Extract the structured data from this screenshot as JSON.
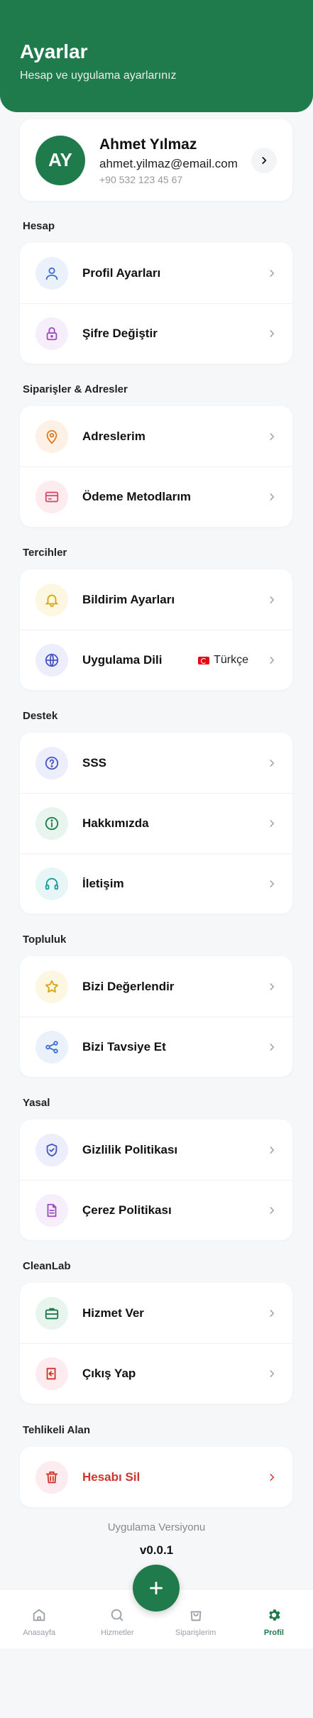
{
  "header": {
    "title": "Ayarlar",
    "subtitle": "Hesap ve uygulama ayarlarınız"
  },
  "profile": {
    "initials": "AY",
    "name": "Ahmet Yılmaz",
    "email": "ahmet.yilmaz@email.com",
    "phone": "+90 532 123 45 67"
  },
  "sections": {
    "hesap": {
      "title": "Hesap",
      "items": [
        {
          "label": "Profil Ayarları",
          "icon": "user-icon"
        },
        {
          "label": "Şifre Değiştir",
          "icon": "lock-icon"
        }
      ]
    },
    "siparis": {
      "title": "Siparişler & Adresler",
      "items": [
        {
          "label": "Adreslerim",
          "icon": "location-pin-icon"
        },
        {
          "label": "Ödeme Metodlarım",
          "icon": "credit-card-icon"
        }
      ]
    },
    "tercihler": {
      "title": "Tercihler",
      "items": [
        {
          "label": "Bildirim Ayarları",
          "icon": "bell-icon"
        },
        {
          "label": "Uygulama Dili",
          "icon": "globe-icon",
          "value": "Türkçe"
        }
      ]
    },
    "destek": {
      "title": "Destek",
      "items": [
        {
          "label": "SSS",
          "icon": "help-circle-icon"
        },
        {
          "label": "Hakkımızda",
          "icon": "info-icon"
        },
        {
          "label": "İletişim",
          "icon": "headphones-icon"
        }
      ]
    },
    "topluluk": {
      "title": "Topluluk",
      "items": [
        {
          "label": "Bizi Değerlendir",
          "icon": "star-icon"
        },
        {
          "label": "Bizi Tavsiye Et",
          "icon": "share-icon"
        }
      ]
    },
    "yasal": {
      "title": "Yasal",
      "items": [
        {
          "label": "Gizlilik Politikası",
          "icon": "shield-check-icon"
        },
        {
          "label": "Çerez Politikası",
          "icon": "document-icon"
        }
      ]
    },
    "cleanlab": {
      "title": "CleanLab",
      "items": [
        {
          "label": "Hizmet Ver",
          "icon": "briefcase-icon"
        },
        {
          "label": "Çıkış Yap",
          "icon": "logout-icon"
        }
      ]
    },
    "tehlikeli": {
      "title": "Tehlikeli Alan",
      "items": [
        {
          "label": "Hesabı Sil",
          "icon": "trash-icon"
        }
      ]
    }
  },
  "version": {
    "label": "Uygulama Versiyonu",
    "value": "v0.0.1"
  },
  "tabbar": {
    "home": "Anasayfa",
    "services": "Hizmetler",
    "orders": "Siparişlerim",
    "profile": "Profil",
    "active": "Profil"
  },
  "colors": {
    "primary": "#1f7a4c",
    "danger": "#d0342c",
    "background": "#f6f7f9"
  }
}
